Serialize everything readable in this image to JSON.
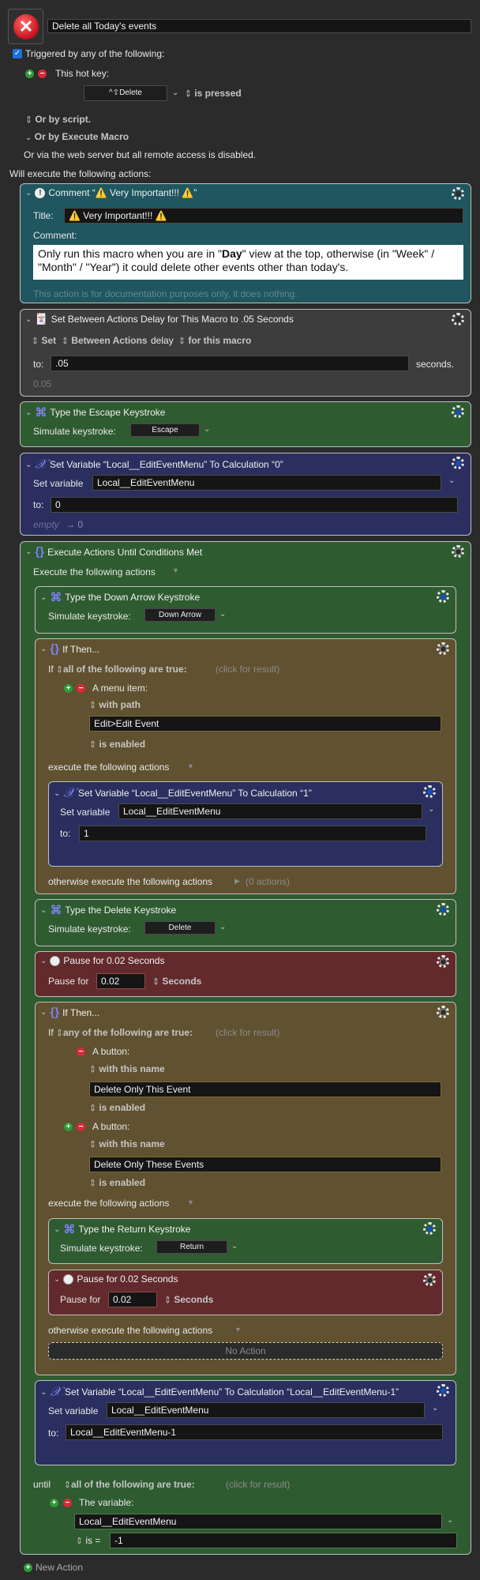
{
  "macro": {
    "name": "Delete all Today's events",
    "icon": "error-x-icon",
    "triggered_checkbox": true,
    "triggered_label": "Triggered by any of the following:",
    "hotkey_label": "This hot key:",
    "hotkey_value": "^⇧Delete",
    "hotkey_state": "is pressed",
    "or_script": "Or by script.",
    "or_execute_macro": "Or by Execute Macro",
    "web_server": "Or via the web server but all remote access is disabled.",
    "will_execute": "Will execute the following actions:"
  },
  "actions": {
    "comment": {
      "header": "Comment “⚠️ Very Important!!! ⚠️”",
      "title_label": "Title:",
      "title_value": "⚠️ Very Important!!! ⚠️",
      "comment_label": "Comment:",
      "comment_pre": "Only run this macro when you are in \"",
      "comment_bold": "Day",
      "comment_post": "\" view at the top, otherwise (in \"Week\" / \"Month\" / \"Year\") it could delete other events other than today's.",
      "footer": "This action is for documentation purposes only, it does nothing."
    },
    "delay": {
      "header": "Set Between Actions Delay for This Macro to .05 Seconds",
      "set": "Set",
      "between": "Between Actions",
      "delay": "delay",
      "for_macro": "for this macro",
      "to_label": "to:",
      "to_value": ".05",
      "seconds": "seconds.",
      "result": "0.05"
    },
    "escape": {
      "header": "Type the Escape Keystroke",
      "label": "Simulate keystroke:",
      "key": "Escape"
    },
    "setvar0": {
      "header": "Set Variable “Local__EditEventMenu” To Calculation “0”",
      "set_label": "Set variable",
      "variable": "Local__EditEventMenu",
      "to_label": "to:",
      "to_value": "0",
      "result_empty": "empty",
      "result_value": "→ 0"
    },
    "until": {
      "header": "Execute Actions Until Conditions Met",
      "execute_label": "Execute the following actions",
      "down": {
        "header": "Type the Down Arrow Keystroke",
        "label": "Simulate keystroke:",
        "key": "Down Arrow"
      },
      "if1": {
        "header": "If Then...",
        "if_label": "If",
        "condition": "all of the following are true:",
        "click_result": "(click for result)",
        "cond_label": "A menu item:",
        "with_path": "with path",
        "path_value": "Edit>Edit Event",
        "is_enabled": "is enabled",
        "execute_label": "execute the following actions",
        "setvar": {
          "header": "Set Variable “Local__EditEventMenu” To Calculation “1”",
          "set_label": "Set variable",
          "variable": "Local__EditEventMenu",
          "to_label": "to:",
          "to_value": "1"
        },
        "otherwise_label": "otherwise execute the following actions",
        "otherwise_count": "(0 actions)"
      },
      "delete": {
        "header": "Type the Delete Keystroke",
        "label": "Simulate keystroke:",
        "key": "Delete"
      },
      "pause1": {
        "header": "Pause for 0.02 Seconds",
        "label": "Pause for",
        "value": "0.02",
        "unit": "Seconds"
      },
      "if2": {
        "header": "If Then...",
        "if_label": "If",
        "condition": "any of the following are true:",
        "click_result": "(click for result)",
        "cond1_label": "A button:",
        "cond1_with": "with this name",
        "cond1_value": "Delete Only This Event",
        "cond1_enabled": "is enabled",
        "cond2_label": "A button:",
        "cond2_with": "with this name",
        "cond2_value": "Delete Only These Events",
        "cond2_enabled": "is enabled",
        "execute_label": "execute the following actions",
        "ret": {
          "header": "Type the Return Keystroke",
          "label": "Simulate keystroke:",
          "key": "Return"
        },
        "pause": {
          "header": "Pause for 0.02 Seconds",
          "label": "Pause for",
          "value": "0.02",
          "unit": "Seconds"
        },
        "otherwise_label": "otherwise execute the following actions",
        "no_action": "No Action"
      },
      "setvar": {
        "header": "Set Variable “Local__EditEventMenu” To Calculation “Local__EditEventMenu-1”",
        "set_label": "Set variable",
        "variable": "Local__EditEventMenu",
        "to_label": "to:",
        "to_value": "Local__EditEventMenu-1"
      },
      "until_label": "until",
      "until_condition": "all of the following are true:",
      "click_result": "(click for result)",
      "var_label": "The variable:",
      "var_value": "Local__EditEventMenu",
      "is_label": "is =",
      "is_value": "-1"
    }
  },
  "new_action": "New Action"
}
